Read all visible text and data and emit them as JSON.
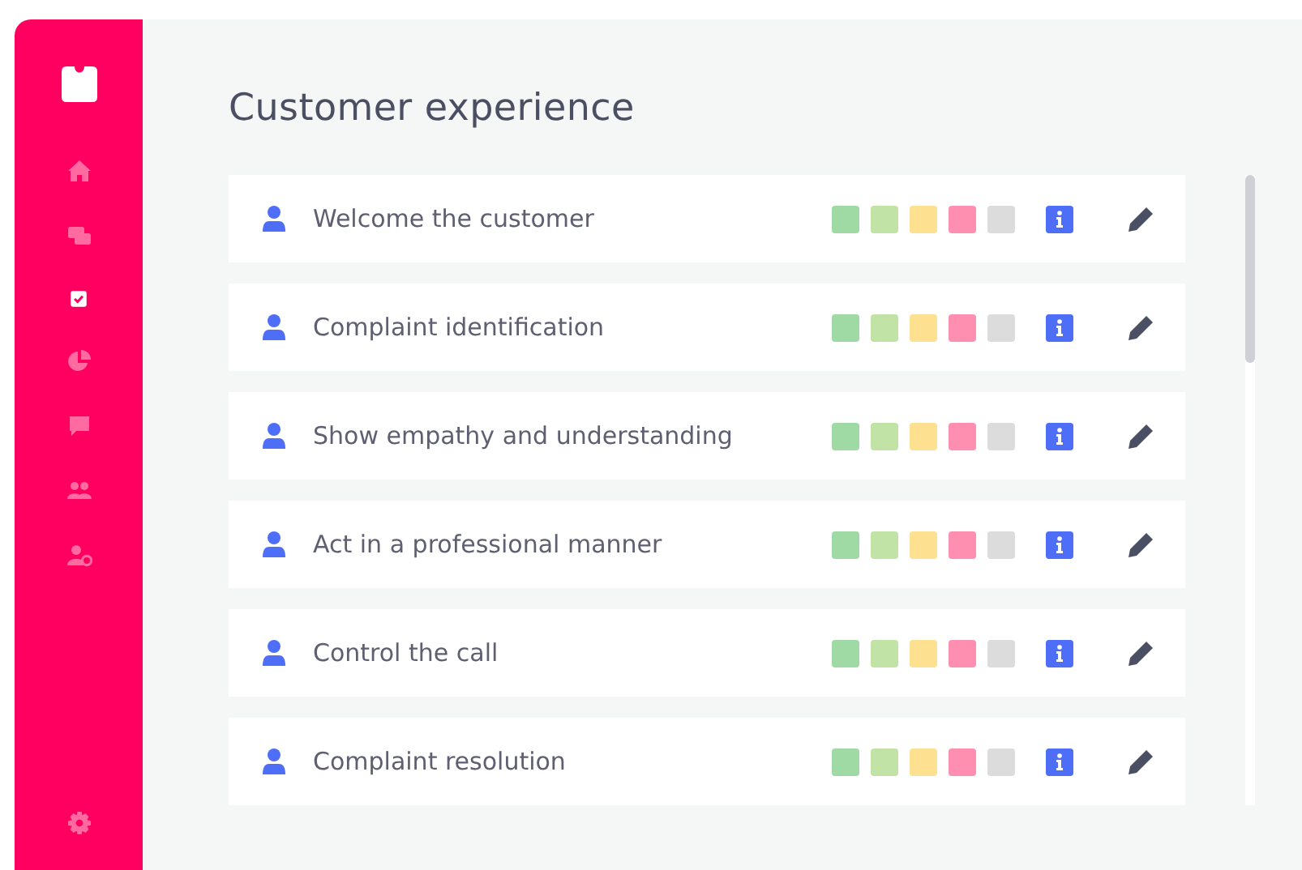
{
  "sidebar": {
    "items": [
      {
        "selected": false
      },
      {
        "selected": false
      },
      {
        "selected": true
      },
      {
        "selected": false
      },
      {
        "selected": false
      },
      {
        "selected": false
      },
      {
        "selected": false
      }
    ]
  },
  "title": "Customer experience",
  "criteria": [
    {
      "label": "Welcome the customer",
      "scale": [
        {
          "color": "#9fd9a3"
        },
        {
          "color": "#c2e3a6"
        },
        {
          "color": "#fde090"
        },
        {
          "color": "#ff8fb0"
        },
        {
          "color": "#dcdcdc"
        }
      ]
    },
    {
      "label": "Complaint identification",
      "scale": [
        {
          "color": "#9fd9a3"
        },
        {
          "color": "#c2e3a6"
        },
        {
          "color": "#fde090"
        },
        {
          "color": "#ff8fb0"
        },
        {
          "color": "#dcdcdc"
        }
      ]
    },
    {
      "label": "Show empathy and understanding",
      "scale": [
        {
          "color": "#9fd9a3"
        },
        {
          "color": "#c2e3a6"
        },
        {
          "color": "#fde090"
        },
        {
          "color": "#ff8fb0"
        },
        {
          "color": "#dcdcdc"
        }
      ]
    },
    {
      "label": "Act in a professional manner",
      "scale": [
        {
          "color": "#9fd9a3"
        },
        {
          "color": "#c2e3a6"
        },
        {
          "color": "#fde090"
        },
        {
          "color": "#ff8fb0"
        },
        {
          "color": "#dcdcdc"
        }
      ]
    },
    {
      "label": "Control the call",
      "scale": [
        {
          "color": "#9fd9a3"
        },
        {
          "color": "#c2e3a6"
        },
        {
          "color": "#fde090"
        },
        {
          "color": "#ff8fb0"
        },
        {
          "color": "#dcdcdc"
        }
      ]
    },
    {
      "label": "Complaint resolution",
      "scale": [
        {
          "color": "#9fd9a3"
        },
        {
          "color": "#c2e3a6"
        },
        {
          "color": "#fde090"
        },
        {
          "color": "#ff8fb0"
        },
        {
          "color": "#dcdcdc"
        }
      ]
    }
  ]
}
